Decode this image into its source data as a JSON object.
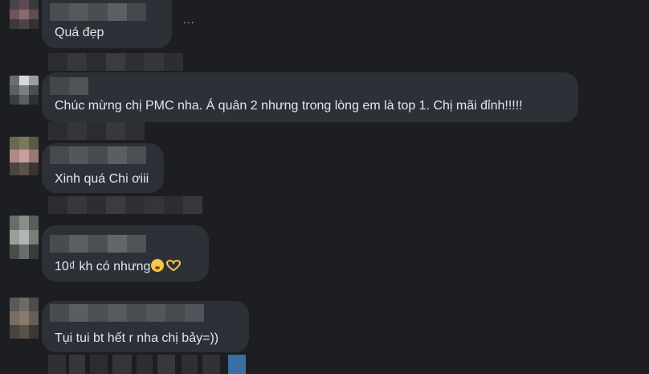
{
  "comments": [
    {
      "text": "Quá đẹp"
    },
    {
      "text": "Chúc mừng chị PMC nha. Á quân 2 nhưng trong lòng em là top 1. Chị mãi đỉnh!!!!!"
    },
    {
      "text": "Xinh quá Chi ơiii"
    },
    {
      "text": "10₫ kh có nhưng",
      "emoji": [
        "thinking-face-icon",
        "heart-hands-icon"
      ]
    },
    {
      "text": "Tụi tui bt hết r nha chị bảy=))"
    }
  ],
  "ellipsis": "...",
  "colors": {
    "background": "#1c1e21",
    "bubble": "#2d3036",
    "text": "#e4e6eb",
    "accent_square": "#3b6ea5"
  }
}
